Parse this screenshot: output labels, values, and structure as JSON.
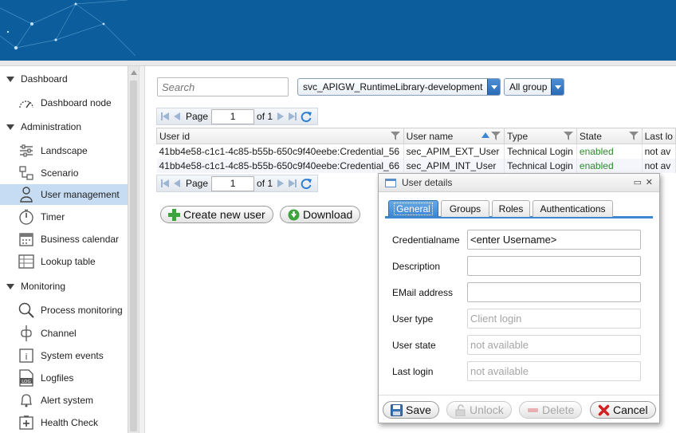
{
  "sidebar": {
    "sections": [
      {
        "label": "Dashboard",
        "items": [
          {
            "label": "Dashboard node",
            "icon": "gauge-icon"
          }
        ]
      },
      {
        "label": "Administration",
        "items": [
          {
            "label": "Landscape",
            "icon": "sliders-icon"
          },
          {
            "label": "Scenario",
            "icon": "scenario-icon"
          },
          {
            "label": "User management",
            "icon": "user-icon"
          },
          {
            "label": "Timer",
            "icon": "timer-icon"
          },
          {
            "label": "Business calendar",
            "icon": "calendar-icon"
          },
          {
            "label": "Lookup table",
            "icon": "table-icon"
          }
        ]
      },
      {
        "label": "Monitoring",
        "items": [
          {
            "label": "Process monitoring",
            "icon": "magnifier-icon"
          },
          {
            "label": "Channel",
            "icon": "channel-icon"
          },
          {
            "label": "System events",
            "icon": "info-icon"
          },
          {
            "label": "Logfiles",
            "icon": "log-icon"
          },
          {
            "label": "Alert system",
            "icon": "bell-icon"
          },
          {
            "label": "Health Check",
            "icon": "health-icon"
          }
        ]
      }
    ],
    "active_item": "User management"
  },
  "toolbar": {
    "search_placeholder": "Search",
    "library_select": "svc_APIGW_RuntimeLibrary-development",
    "group_select": "All group"
  },
  "pager_top": {
    "page_label": "Page",
    "page_value": "1",
    "of_label": "of 1"
  },
  "pager_bottom": {
    "page_label": "Page",
    "page_value": "1",
    "of_label": "of 1"
  },
  "grid": {
    "columns": [
      "User id",
      "User name",
      "Type",
      "State",
      "Last lo"
    ],
    "rows": [
      {
        "user_id": "41bb4e58-c1c1-4c85-b55b-650c9f40eebe:Credential_56",
        "user_name": "sec_APIM_EXT_User",
        "type": "Technical Login",
        "state": "enabled",
        "last": "not av"
      },
      {
        "user_id": "41bb4e58-c1c1-4c85-b55b-650c9f40eebe:Credential_66",
        "user_name": "sec_APIM_INT_User",
        "type": "Technical Login",
        "state": "enabled",
        "last": "not av"
      }
    ]
  },
  "actions": {
    "create_label": "Create new user",
    "download_label": "Download"
  },
  "dialog": {
    "title": "User details",
    "tabs": [
      "General",
      "Groups",
      "Roles",
      "Authentications"
    ],
    "active_tab": "General",
    "fields": {
      "credentialname": {
        "label": "Credentialname",
        "value": "<enter Username>"
      },
      "description": {
        "label": "Description",
        "value": ""
      },
      "email": {
        "label": "EMail address",
        "value": ""
      },
      "user_type": {
        "label": "User type",
        "value": "Client login"
      },
      "user_state": {
        "label": "User state",
        "value": "not available"
      },
      "last_login": {
        "label": "Last login",
        "value": "not available"
      }
    },
    "buttons": {
      "save": "Save",
      "unlock": "Unlock",
      "delete": "Delete",
      "cancel": "Cancel"
    }
  },
  "colors": {
    "header_blue": "#0b5e9b",
    "accent_blue": "#3d86d0",
    "selection": "#c6dcf2",
    "enabled_green": "#2a8a2a"
  }
}
